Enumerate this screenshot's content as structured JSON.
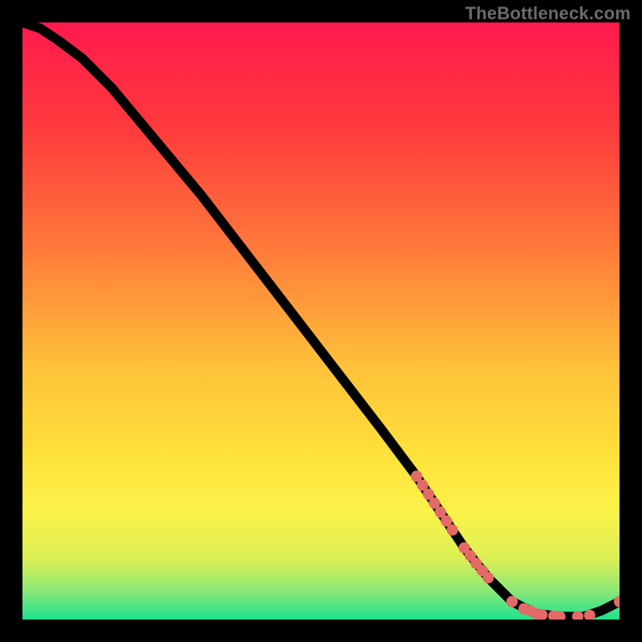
{
  "watermark": "TheBottleneck.com",
  "colors": {
    "background": "#000000",
    "curve": "#000000",
    "marker": "#e46a67",
    "gradient_stops": [
      {
        "pct": 0,
        "color": "#ff1a4d"
      },
      {
        "pct": 18,
        "color": "#ff3b3d"
      },
      {
        "pct": 38,
        "color": "#ff7a3a"
      },
      {
        "pct": 58,
        "color": "#ffc23a"
      },
      {
        "pct": 72,
        "color": "#ffe03a"
      },
      {
        "pct": 82,
        "color": "#fbf24a"
      },
      {
        "pct": 90,
        "color": "#d9ef55"
      },
      {
        "pct": 95,
        "color": "#8fe876"
      },
      {
        "pct": 100,
        "color": "#1de18e"
      }
    ]
  },
  "chart_data": {
    "type": "line",
    "title": "",
    "xlabel": "",
    "ylabel": "",
    "xlim": [
      0,
      100
    ],
    "ylim": [
      0,
      100
    ],
    "grid": false,
    "series": [
      {
        "name": "curve",
        "x": [
          0,
          3,
          6,
          10,
          15,
          20,
          30,
          40,
          50,
          60,
          66,
          70,
          74,
          78,
          82,
          86,
          90,
          94,
          97,
          100
        ],
        "y": [
          100,
          99,
          97,
          94,
          89,
          83,
          71,
          58,
          45,
          32,
          24,
          18,
          12,
          7,
          3,
          1,
          0.5,
          0.5,
          1.5,
          3
        ]
      }
    ],
    "markers": [
      {
        "name": "highlight-cluster-1",
        "x": [
          66,
          67,
          68,
          69,
          70,
          71,
          72
        ],
        "y": [
          24,
          22.5,
          21,
          19.5,
          18,
          16.5,
          15
        ]
      },
      {
        "name": "highlight-cluster-2",
        "x": [
          74,
          75,
          76,
          77,
          78
        ],
        "y": [
          12,
          10.7,
          9.4,
          8.2,
          7
        ]
      },
      {
        "name": "highlight-bottom",
        "x": [
          82,
          84,
          85,
          86,
          87,
          89,
          90,
          93,
          95,
          100
        ],
        "y": [
          3,
          1.8,
          1.5,
          1,
          0.8,
          0.6,
          0.5,
          0.5,
          0.7,
          3
        ]
      }
    ]
  }
}
